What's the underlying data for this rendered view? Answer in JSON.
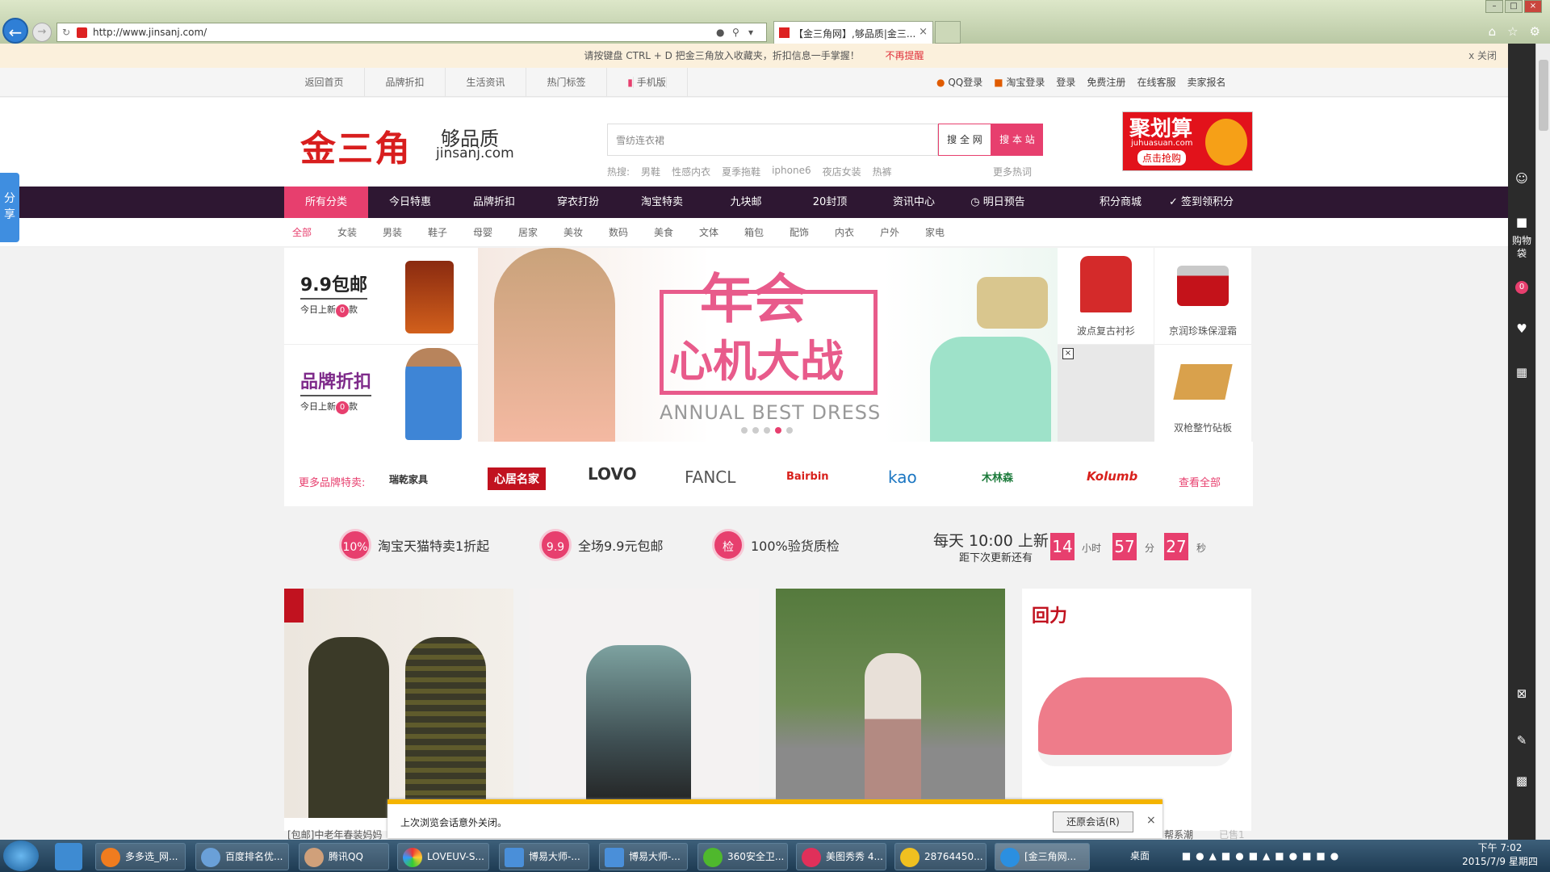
{
  "browser": {
    "url": "http://www.jinsanj.com/",
    "tab_title": "【金三角网】,够品质|金三...",
    "tab_close": "×"
  },
  "notice": {
    "text": "请按键盘 CTRL + D 把金三角放入收藏夹，折扣信息一手掌握！",
    "dismiss": "不再提醒",
    "close": "x 关闭"
  },
  "topbar": {
    "left": [
      "返回首页",
      "品牌折扣",
      "生活资讯",
      "热门标签",
      "手机版"
    ],
    "right": [
      "QQ登录",
      "淘宝登录",
      "登录",
      "免费注册",
      "在线客服",
      "卖家报名"
    ]
  },
  "header": {
    "logo": "金三角",
    "slogan": "够品质",
    "domain": "jinsanj.com",
    "search_placeholder": "雪纺连衣裙",
    "btn_all": "搜 全 网",
    "btn_site": "搜 本 站",
    "hot_label": "热搜:",
    "hot": [
      "男鞋",
      "性感内衣",
      "夏季拖鞋",
      "iphone6",
      "夜店女装",
      "热裤"
    ],
    "more_hot": "更多热词",
    "ad_title": "聚划算",
    "ad_domain": "juhuasuan.com",
    "ad_btn": "点击抢购"
  },
  "mainnav": [
    "所有分类",
    "今日特惠",
    "品牌折扣",
    "穿衣打扮",
    "淘宝特卖",
    "九块邮",
    "20封顶",
    "资讯中心",
    "明日预告"
  ],
  "mainnav_right": [
    "积分商城",
    "签到领积分"
  ],
  "subnav": [
    "全部",
    "女装",
    "男装",
    "鞋子",
    "母婴",
    "居家",
    "美妆",
    "数码",
    "美食",
    "文体",
    "箱包",
    "配饰",
    "内衣",
    "户外",
    "家电"
  ],
  "promos": [
    {
      "title": "9.9包邮",
      "sub1": "今日上新",
      "count": "0",
      "sub2": "款"
    },
    {
      "title": "品牌折扣",
      "sub1": "今日上新",
      "count": "0",
      "sub2": "款"
    }
  ],
  "banner": {
    "line1": "年会",
    "line2": "心机大战",
    "line3": "ANNUAL BEST DRESS"
  },
  "tiles": [
    {
      "label": "波点复古衬衫"
    },
    {
      "label": "京润珍珠保湿霜"
    },
    {
      "label": "双枪整竹砧板"
    }
  ],
  "brands": {
    "lead": "更多品牌特卖:",
    "items": [
      "瑞乾家具",
      "心居名家",
      "LOVO",
      "FANCL",
      "Bairbin",
      "kao",
      "木林森",
      "Kolumb"
    ],
    "all": "查看全部"
  },
  "features": [
    {
      "badge": "10%",
      "text": "淘宝天猫特卖1折起"
    },
    {
      "badge": "9.9",
      "text": "全场9.9元包邮"
    },
    {
      "badge": "检",
      "text": "100%验货质检"
    }
  ],
  "countdown": {
    "title": "每天 10:00 上新",
    "sub": "距下次更新还有",
    "hours": "14",
    "hours_label": "小时",
    "minutes": "57",
    "minutes_label": "分",
    "seconds": "27",
    "seconds_label": "秒"
  },
  "products": [
    {
      "caption": "[包邮]中老年春装妈妈"
    },
    {
      "caption": ""
    },
    {
      "caption": ""
    },
    {
      "caption": "帮系潮",
      "sold": "已售1"
    }
  ],
  "sidebar": {
    "share": "分享",
    "bag": "购物袋",
    "bag_count": "0"
  },
  "restore": {
    "msg": "上次浏览会话意外关闭。",
    "btn": "还原会话(R)",
    "close": "×"
  },
  "taskbar": {
    "tasks": [
      "多多选_网...",
      "百度排名优...",
      "腾讯QQ",
      "LOVEUV-S...",
      "博易大师-...",
      "博易大师-...",
      "360安全卫...",
      "美图秀秀 4...",
      "28764450...",
      "[金三角网..."
    ],
    "desktop": "桌面",
    "time": "下午 7:02",
    "date": "2015/7/9 星期四"
  },
  "colors": {
    "accent": "#e73f6e",
    "nav_bg": "#2e1732",
    "logo": "#d81e1e"
  }
}
